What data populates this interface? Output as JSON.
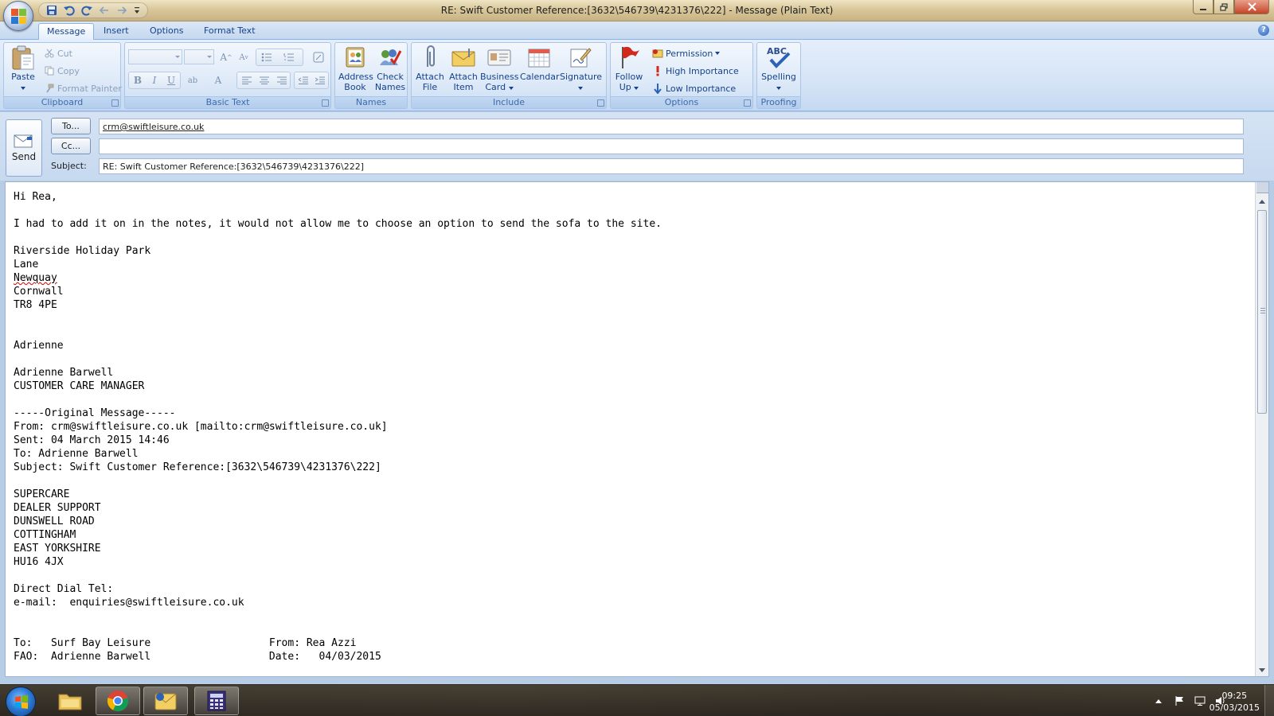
{
  "window": {
    "title": "RE: Swift Customer Reference:[3632\\546739\\4231376\\222] - Message (Plain Text)"
  },
  "tabs": [
    "Message",
    "Insert",
    "Options",
    "Format Text"
  ],
  "ribbon": {
    "clipboard": {
      "label": "Clipboard",
      "paste": "Paste",
      "cut": "Cut",
      "copy": "Copy",
      "format_painter": "Format Painter"
    },
    "basic_text": {
      "label": "Basic Text"
    },
    "names": {
      "label": "Names",
      "address_book": [
        "Address",
        "Book"
      ],
      "check_names": [
        "Check",
        "Names"
      ]
    },
    "include": {
      "label": "Include",
      "attach_file": [
        "Attach",
        "File"
      ],
      "attach_item": [
        "Attach",
        "Item"
      ],
      "business_card": [
        "Business",
        "Card"
      ],
      "calendar": "Calendar",
      "signature": "Signature"
    },
    "options": {
      "label": "Options",
      "follow_up": [
        "Follow",
        "Up"
      ],
      "permission": "Permission",
      "high_importance": "High Importance",
      "low_importance": "Low Importance"
    },
    "proofing": {
      "label": "Proofing",
      "spelling": "Spelling"
    }
  },
  "compose": {
    "send": "Send",
    "to_button": "To...",
    "cc_button": "Cc...",
    "subject_label": "Subject:",
    "to_value": "crm@swiftleisure.co.uk",
    "cc_value": "",
    "subject_value": "RE: Swift Customer Reference:[3632\\546739\\4231376\\222]"
  },
  "body": {
    "lines": [
      "Hi Rea,",
      "",
      "I had to add it on in the notes, it would not allow me to choose an option to send the sofa to the site.",
      "",
      "Riverside Holiday Park",
      "Lane",
      "Newquay",
      "Cornwall",
      "TR8 4PE",
      "",
      "",
      "Adrienne",
      "",
      "Adrienne Barwell",
      "CUSTOMER CARE MANAGER",
      "",
      "-----Original Message-----",
      "From: crm@swiftleisure.co.uk [mailto:crm@swiftleisure.co.uk]",
      "Sent: 04 March 2015 14:46",
      "To: Adrienne Barwell",
      "Subject: Swift Customer Reference:[3632\\546739\\4231376\\222]",
      "",
      "SUPERCARE",
      "DEALER SUPPORT",
      "DUNSWELL ROAD",
      "COTTINGHAM",
      "EAST YORKSHIRE",
      "HU16 4JX",
      "",
      "Direct Dial Tel:",
      "e-mail:  enquiries@swiftleisure.co.uk",
      "",
      "",
      "To:   Surf Bay Leisure                   From: Rea Azzi",
      "FAO:  Adrienne Barwell                   Date:   04/03/2015"
    ],
    "misspelled_word": "Newquay"
  },
  "taskbar": {
    "apps": [
      "windows-explorer",
      "google-chrome",
      "microsoft-outlook",
      "calculator-app"
    ],
    "time": "09:25",
    "date": "05/03/2015"
  },
  "colors": {
    "ribbon_text": "#15428b",
    "title_bar": "#d9c89b",
    "flag_red": "#d12a1c"
  }
}
